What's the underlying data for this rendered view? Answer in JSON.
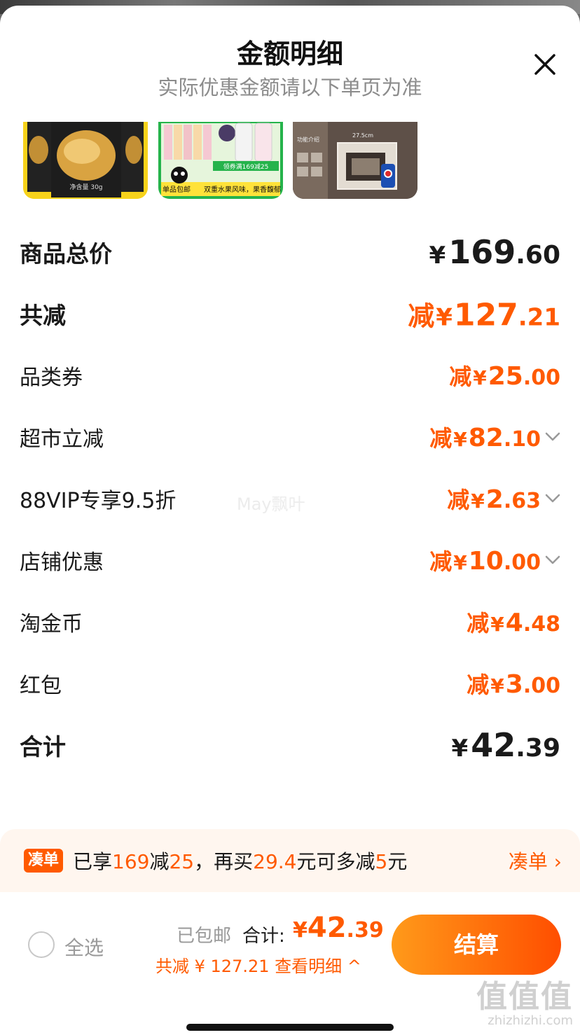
{
  "sheet": {
    "title": "金额明细",
    "subtitle": "实际优惠金额请以下单页为准"
  },
  "icons": {
    "close": "close-icon",
    "chevron": "chevron-down-icon"
  },
  "colors": {
    "accent": "#ff5a00",
    "checkout_gradient_start": "#ff9a1a",
    "checkout_gradient_end": "#ff4e00",
    "promo_bg": "#fff6ef"
  },
  "products": [
    {
      "name": "product-thumb-snack",
      "text": "净含量 30g"
    },
    {
      "name": "product-thumb-drinks",
      "text_1": "领券满169减25",
      "text_2": "双重水果风味，果香馥郁",
      "badge": "单品包邮"
    },
    {
      "name": "product-thumb-storage",
      "dims": "27.5cm",
      "tag": "功能介绍"
    }
  ],
  "rows": {
    "total_price": {
      "label": "商品总价",
      "yen": "¥",
      "int": "169",
      "dec": ".60"
    },
    "total_reduced": {
      "label": "共减",
      "pre": "减",
      "yen": "¥",
      "int": "127",
      "dec": ".21"
    },
    "category_coupon": {
      "label": "品类券",
      "pre": "减",
      "yen": "¥",
      "int": "25",
      "dec": ".00"
    },
    "supermarket": {
      "label": "超市立减",
      "pre": "减",
      "yen": "¥",
      "int": "82",
      "dec": ".10"
    },
    "vip": {
      "label": "88VIP专享9.5折",
      "pre": "减",
      "yen": "¥",
      "int": "2",
      "dec": ".63"
    },
    "store": {
      "label": "店铺优惠",
      "pre": "减",
      "yen": "¥",
      "int": "10",
      "dec": ".00"
    },
    "gold_coin": {
      "label": "淘金币",
      "pre": "减",
      "yen": "¥",
      "int": "4",
      "dec": ".48"
    },
    "red_packet": {
      "label": "红包",
      "pre": "减",
      "yen": "¥",
      "int": "3",
      "dec": ".00"
    },
    "sum": {
      "label": "合计",
      "yen": "¥",
      "int": "42",
      "dec": ".39"
    }
  },
  "watermark": "May飘叶",
  "promo": {
    "tag": "凑单",
    "t1": "已享",
    "h1": "169",
    "t2": "减",
    "h2": "25",
    "t3": "，再买",
    "h3": "29.4",
    "t4": "元可多减",
    "h4": "5",
    "t5": "元",
    "link": "凑单 ›"
  },
  "bottom": {
    "select_all": "全选",
    "shipping": "已包邮",
    "total_label": "合计:",
    "total_yen": "¥",
    "total_int": "42",
    "total_dec": ".39",
    "reduced": "共减 ¥ 127.21  查看明细 ^",
    "checkout": "结算"
  },
  "site_mark": {
    "glyphs": "值值值",
    "url": "zhizhizhi.com"
  }
}
